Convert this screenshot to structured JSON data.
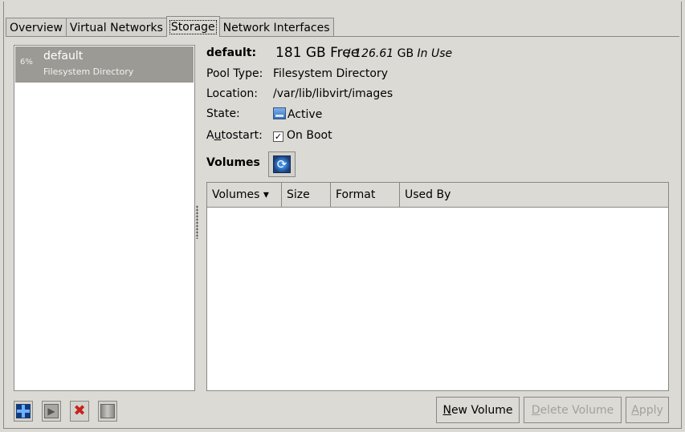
{
  "tabs": [
    {
      "label": "Overview"
    },
    {
      "label": "Virtual Networks"
    },
    {
      "label": "Storage"
    },
    {
      "label": "Network Interfaces"
    }
  ],
  "pool_list": {
    "items": [
      {
        "usage": "6%",
        "name": "default",
        "type": "Filesystem Directory"
      }
    ]
  },
  "pool_detail": {
    "title": "default:",
    "free": "181 GB Free",
    "sep": " / ",
    "in_use_value": "126.61",
    "in_use_unit": " GB ",
    "in_use_label": "In Use",
    "pool_type_label": "Pool Type:",
    "pool_type": "Filesystem Directory",
    "location_label": "Location:",
    "location": "/var/lib/libvirt/images",
    "state_label": "State:",
    "state": "Active",
    "autostart_label_pre": "A",
    "autostart_label_u": "u",
    "autostart_label_post": "tostart:",
    "autostart": "On Boot",
    "autostart_checked": "✓"
  },
  "volumes": {
    "label": "Volumes",
    "columns": [
      "Volumes ▾",
      "Size",
      "Format",
      "Used By"
    ],
    "rows": []
  },
  "buttons": {
    "new_volume_u": "N",
    "new_volume_rest": "ew Volume",
    "delete_volume_u": "D",
    "delete_volume_rest": "elete Volume",
    "apply_u": "A",
    "apply_rest": "pply"
  },
  "colors": {
    "selected_row": "#9c9a94",
    "background": "#dcdad5"
  }
}
